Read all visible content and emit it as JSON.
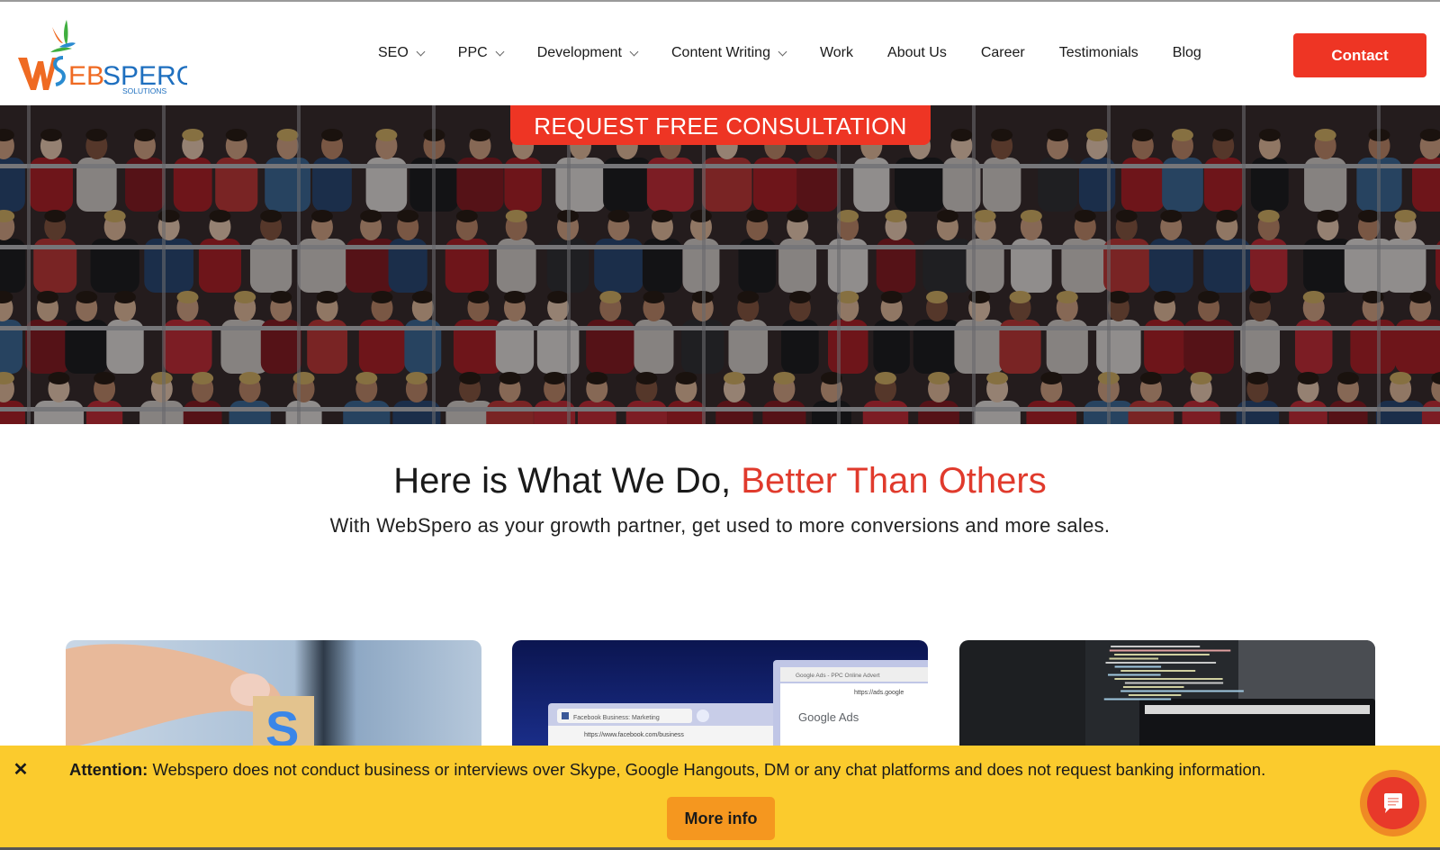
{
  "header": {
    "logo": {
      "main_text": "WEBSPERO",
      "sub_text": "SOLUTIONS",
      "alt": "WebSpero Solutions logo"
    },
    "nav": [
      {
        "label": "SEO",
        "has_dropdown": true
      },
      {
        "label": "PPC",
        "has_dropdown": true
      },
      {
        "label": "Development",
        "has_dropdown": true
      },
      {
        "label": "Content Writing",
        "has_dropdown": true
      },
      {
        "label": "Work",
        "has_dropdown": false
      },
      {
        "label": "About Us",
        "has_dropdown": false
      },
      {
        "label": "Career",
        "has_dropdown": false
      },
      {
        "label": "Testimonials",
        "has_dropdown": false
      },
      {
        "label": "Blog",
        "has_dropdown": false
      }
    ],
    "contact_label": "Contact"
  },
  "hero": {
    "cta_label": "REQUEST FREE CONSULTATION",
    "image_desc": "crowd of spectators in stadium stands"
  },
  "section": {
    "title_main": "Here is What We Do, ",
    "title_accent": "Better Than Others",
    "subtitle": "With WebSpero as your growth partner, get used to more conversions and more sales."
  },
  "cards": [
    {
      "name": "seo",
      "image_desc": "hand holding a wooden letter S block"
    },
    {
      "name": "ppc",
      "image_desc": "browser windows showing Facebook Business and Google Ads",
      "tab1": "Facebook Business: Marketing",
      "url1": "https://www.facebook.com/business",
      "tab2": "Google Ads - PPC Online Advert",
      "url2": "https://ads.google",
      "brand": "Google Ads"
    },
    {
      "name": "development",
      "image_desc": "code on monitors and laptop"
    }
  ],
  "attention_bar": {
    "close_icon": "close-icon",
    "label": "Attention:",
    "message": " Webspero does not conduct business or interviews over Skype, Google Hangouts, DM or any chat platforms and does not request banking information.",
    "more_info_label": "More info",
    "chat_icon": "chat-bubble-icon"
  },
  "colors": {
    "brand_red": "#ee3524",
    "attention_yellow": "#fbcb2d",
    "more_info_orange": "#f5971f",
    "accent_text": "#e03a2c"
  }
}
